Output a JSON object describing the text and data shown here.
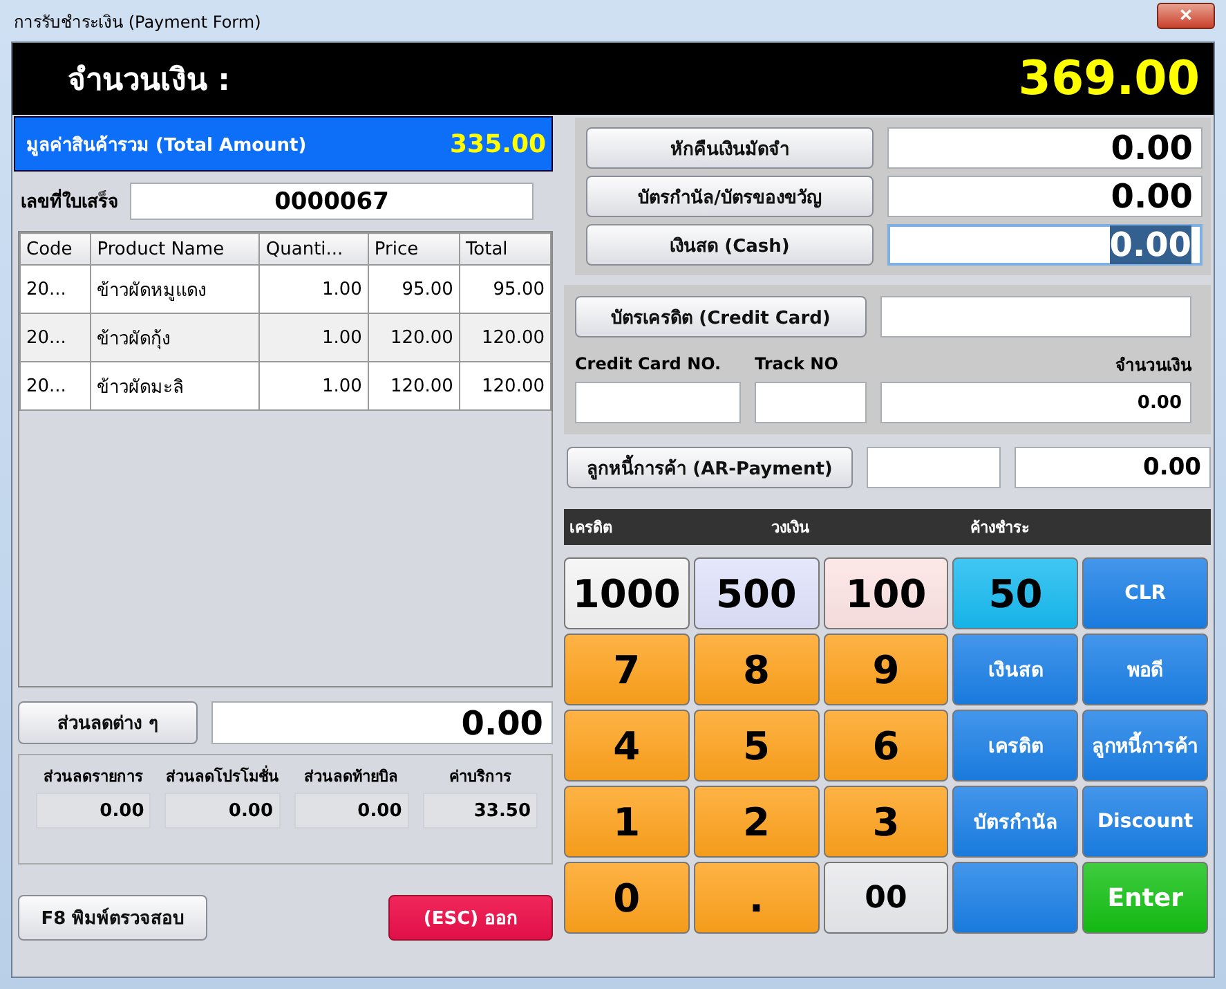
{
  "window": {
    "title": "การรับชำระเงิน (Payment Form)",
    "close": "✕"
  },
  "amount_header": {
    "label": "จำนวนเงิน :",
    "value": "369.00"
  },
  "total_amount": {
    "label": "มูลค่าสินค้ารวม (Total Amount)",
    "value": "335.00"
  },
  "receipt": {
    "label": "เลขที่ใบเสร็จ",
    "value": "0000067"
  },
  "table": {
    "columns": [
      "Code",
      "Product Name",
      "Quanti...",
      "Price",
      "Total"
    ],
    "rows": [
      [
        "20...",
        "ข้าวผัดหมูแดง",
        "1.00",
        "95.00",
        "95.00"
      ],
      [
        "20...",
        "ข้าวผัดกุ้ง",
        "1.00",
        "120.00",
        "120.00"
      ],
      [
        "20...",
        "ข้าวผัดมะลิ",
        "1.00",
        "120.00",
        "120.00"
      ]
    ]
  },
  "discount": {
    "button": "ส่วนลดต่าง ๆ",
    "value": "0.00"
  },
  "summary": [
    {
      "label": "ส่วนลดรายการ",
      "value": "0.00"
    },
    {
      "label": "ส่วนลดโปรโมชั่น",
      "value": "0.00"
    },
    {
      "label": "ส่วนลดท้ายบิล",
      "value": "0.00"
    },
    {
      "label": "ค่าบริการ",
      "value": "33.50"
    }
  ],
  "footer_buttons": {
    "print": "F8 พิมพ์ตรวจสอบ",
    "exit": "(ESC) ออก"
  },
  "payments": [
    {
      "button": "หักคืนเงินมัดจำ",
      "value": "0.00",
      "focused": false
    },
    {
      "button": "บัตรกำนัล/บัตรของขวัญ",
      "value": "0.00",
      "focused": false
    },
    {
      "button": "เงินสด (Cash)",
      "value": "0.00",
      "focused": true
    }
  ],
  "credit_card": {
    "button": "บัตรเครดิต (Credit Card)",
    "card_no_label": "Credit Card NO.",
    "track_label": "Track NO",
    "amount_label": "จำนวนเงิน",
    "amount_value": "0.00"
  },
  "ar_payment": {
    "button": "ลูกหนี้การค้า (AR-Payment)",
    "value": "0.00"
  },
  "credit_strip": [
    "เครดิต",
    "วงเงิน",
    "ค้างชำระ"
  ],
  "keypad": [
    {
      "label": "1000",
      "kind": "digit",
      "color": "#f4f4f4"
    },
    {
      "label": "500",
      "kind": "digit",
      "color": "#e0e2fc"
    },
    {
      "label": "100",
      "kind": "digit",
      "color": "#fde3e3"
    },
    {
      "label": "50",
      "kind": "digit",
      "color": "#17baf0"
    },
    {
      "label": "CLR",
      "kind": "action",
      "color": "#1a7fe6"
    },
    {
      "label": "7",
      "kind": "digit",
      "color": "#fea21c"
    },
    {
      "label": "8",
      "kind": "digit",
      "color": "#fea21c"
    },
    {
      "label": "9",
      "kind": "digit",
      "color": "#fea21c"
    },
    {
      "label": "เงินสด",
      "kind": "action",
      "color": "#1a7fe6"
    },
    {
      "label": "พอดี",
      "kind": "action",
      "color": "#1a7fe6"
    },
    {
      "label": "4",
      "kind": "digit",
      "color": "#fea21c"
    },
    {
      "label": "5",
      "kind": "digit",
      "color": "#fea21c"
    },
    {
      "label": "6",
      "kind": "digit",
      "color": "#fea21c"
    },
    {
      "label": "เครดิต",
      "kind": "action",
      "color": "#1a7fe6"
    },
    {
      "label": "ลูกหนี้การค้า",
      "kind": "action",
      "color": "#1a7fe6"
    },
    {
      "label": "1",
      "kind": "digit",
      "color": "#fea21c"
    },
    {
      "label": "2",
      "kind": "digit",
      "color": "#fea21c"
    },
    {
      "label": "3",
      "kind": "digit",
      "color": "#fea21c"
    },
    {
      "label": "บัตรกำนัล",
      "kind": "action",
      "color": "#1a7fe6"
    },
    {
      "label": "Discount",
      "kind": "action",
      "color": "#1a7fe6"
    },
    {
      "label": "0",
      "kind": "digit",
      "color": "#fea21c"
    },
    {
      "label": ".",
      "kind": "digit",
      "color": "#fea21c"
    },
    {
      "label": "00",
      "kind": "medium",
      "color": "#e8e9ec"
    },
    {
      "kind": "blank",
      "color": "#1a7fe6"
    },
    {
      "label": "Enter",
      "kind": "enter",
      "color": "#14c014"
    }
  ]
}
